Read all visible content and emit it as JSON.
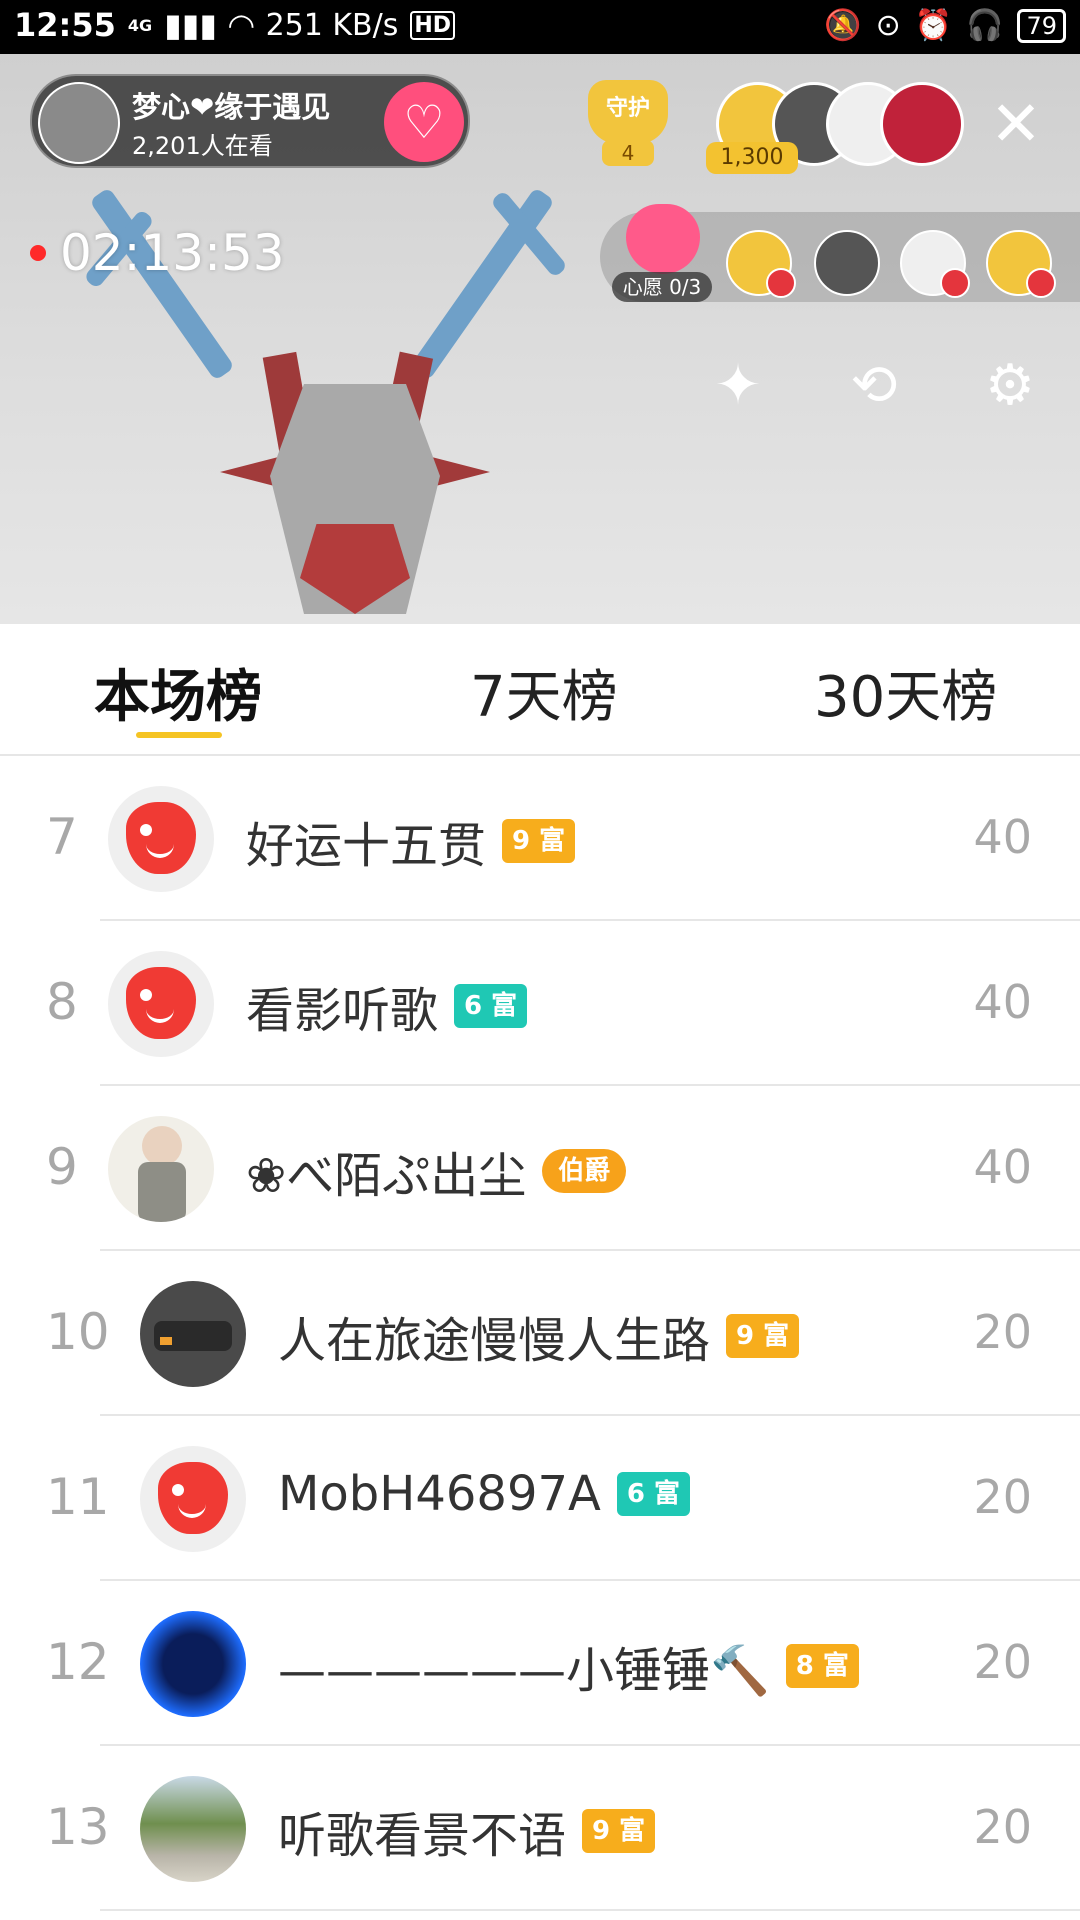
{
  "status_bar": {
    "time": "12:55",
    "network": "4G",
    "speed": "251 KB/s",
    "hd": "HD",
    "battery": "79"
  },
  "live": {
    "host_name": "梦心❤缘于遇见",
    "viewers": "2,201人在看",
    "guard_label": "守护",
    "guard_count": "4",
    "fan_score": "1,300",
    "close_icon": "close-icon",
    "timer": "02:13:53",
    "wish_label": "心愿 0/3",
    "tools": [
      "magic-wand-icon",
      "camera-switch-icon",
      "settings-gear-icon"
    ]
  },
  "tabs": [
    {
      "label": "本场榜",
      "active": true
    },
    {
      "label": "7天榜",
      "active": false
    },
    {
      "label": "30天榜",
      "active": false
    }
  ],
  "ranking": [
    {
      "rank": "7",
      "name": "好运十五贯",
      "badge": "9 富",
      "badge_color": "#f7ad1c",
      "score": "40"
    },
    {
      "rank": "8",
      "name": "看影听歌",
      "badge": "6 富",
      "badge_color": "#1fc8b4",
      "score": "40"
    },
    {
      "rank": "9",
      "name": "❀べ陌ぷ出尘",
      "badge": "伯爵",
      "badge_color": "#f7a21a",
      "score": "40"
    },
    {
      "rank": "10",
      "name": "人在旅途慢慢人生路",
      "badge": "9 富",
      "badge_color": "#f7ad1c",
      "score": "20"
    },
    {
      "rank": "11",
      "name": "MobH46897A",
      "badge": "6 富",
      "badge_color": "#1fc8b4",
      "score": "20"
    },
    {
      "rank": "12",
      "name": "——————小锤锤🔨",
      "badge": "8 富",
      "badge_color": "#f7ad1c",
      "score": "20"
    },
    {
      "rank": "13",
      "name": "听歌看景不语",
      "badge": "9 富",
      "badge_color": "#f7ad1c",
      "score": "20"
    }
  ]
}
